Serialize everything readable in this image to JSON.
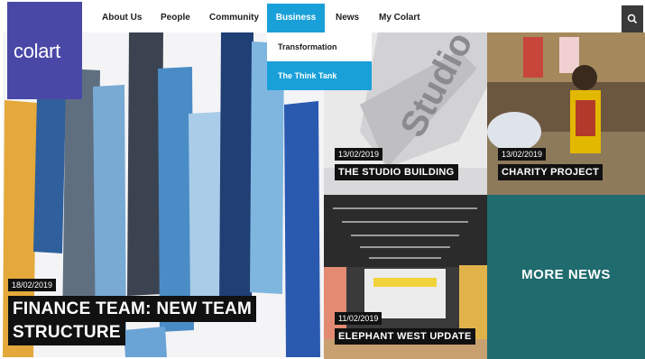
{
  "brand": {
    "logo_text": "colart",
    "color": "#4a48a6"
  },
  "nav": {
    "items": [
      {
        "label": "About Us"
      },
      {
        "label": "People"
      },
      {
        "label": "Community"
      },
      {
        "label": "Business",
        "active": true
      },
      {
        "label": "News"
      },
      {
        "label": "My Colart"
      }
    ],
    "search_icon": "search-icon",
    "active_color": "#1aa0d8"
  },
  "dropdown": {
    "items": [
      {
        "label": "Transformation"
      },
      {
        "label": "The Think Tank",
        "highlighted": true
      }
    ]
  },
  "tiles": {
    "hero": {
      "date": "18/02/2019",
      "title_line1": "FINANCE TEAM: NEW TEAM",
      "title_line2": "STRUCTURE"
    },
    "studio": {
      "date": "13/02/2019",
      "title": "THE STUDIO BUILDING"
    },
    "charity": {
      "date": "13/02/2019",
      "title": "CHARITY PROJECT"
    },
    "elephant": {
      "date": "11/02/2019",
      "title": "ELEPHANT WEST UPDATE"
    },
    "more": {
      "label": "MORE NEWS",
      "color": "#1f6b6e"
    }
  }
}
